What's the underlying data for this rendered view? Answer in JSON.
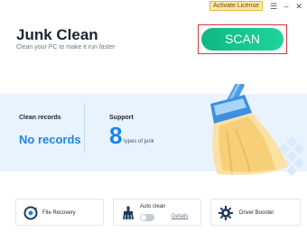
{
  "window": {
    "activate_label": "Activate License",
    "menu_glyph": "☰",
    "minimize_glyph": "–",
    "close_glyph": "✕"
  },
  "header": {
    "title": "Junk Clean",
    "subtitle": "Clean your PC to make it run faster",
    "scan_label": "SCAN"
  },
  "stats": {
    "clean_records_label": "Clean records",
    "clean_records_value": "No records",
    "support_label": "Support",
    "support_value": "8",
    "support_suffix": "types of junk"
  },
  "tools": {
    "file_recovery": {
      "label": "File Recovery",
      "icon": "file-recovery-icon"
    },
    "auto_clean": {
      "label": "Auto clean",
      "details_label": "Details",
      "icon": "auto-clean-brush-icon",
      "enabled": false
    },
    "driver_booster": {
      "label": "Driver Booster",
      "icon": "gear-icon"
    }
  },
  "colors": {
    "accent_blue": "#1a86e6",
    "scan_green": "#10b783",
    "panel_bg": "#e8f3fd",
    "highlight_red": "#d63a3a"
  }
}
